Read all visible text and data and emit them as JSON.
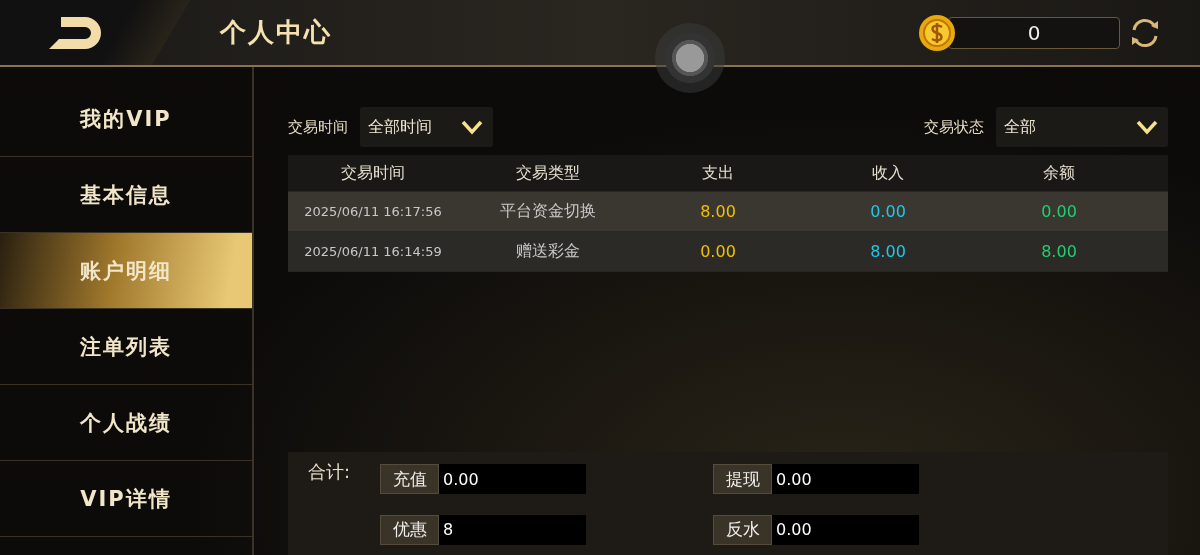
{
  "header": {
    "title": "个人中心",
    "balance": "0"
  },
  "sidebar": {
    "items": [
      {
        "label": "我的VIP",
        "selected": false
      },
      {
        "label": "基本信息",
        "selected": false
      },
      {
        "label": "账户明细",
        "selected": true
      },
      {
        "label": "注单列表",
        "selected": false
      },
      {
        "label": "个人战绩",
        "selected": false
      },
      {
        "label": "VIP详情",
        "selected": false
      }
    ]
  },
  "filters": [
    {
      "label": "交易时间",
      "value": "全部时间"
    },
    {
      "label": "交易状态",
      "value": "全部"
    }
  ],
  "table": {
    "columns": [
      {
        "label": "交易时间",
        "color": "#c8c8c8"
      },
      {
        "label": "交易类型",
        "color": "#c8c8c8"
      },
      {
        "label": "支出",
        "color": "#f0c000"
      },
      {
        "label": "收入",
        "color": "#20c8e8"
      },
      {
        "label": "余额",
        "color": "#20d070"
      }
    ],
    "rows": [
      [
        "2025/06/11 16:17:56",
        "平台资金切换",
        "8.00",
        "0.00",
        "0.00"
      ],
      [
        "2025/06/11 16:14:59",
        "赠送彩金",
        "0.00",
        "8.00",
        "8.00"
      ]
    ]
  },
  "summary": {
    "label": "合计:",
    "fields": [
      {
        "label": "充值",
        "value": "0.00"
      },
      {
        "label": "提现",
        "value": "0.00"
      },
      {
        "label": "优惠",
        "value": "8"
      },
      {
        "label": "反水",
        "value": "0.00"
      }
    ]
  }
}
